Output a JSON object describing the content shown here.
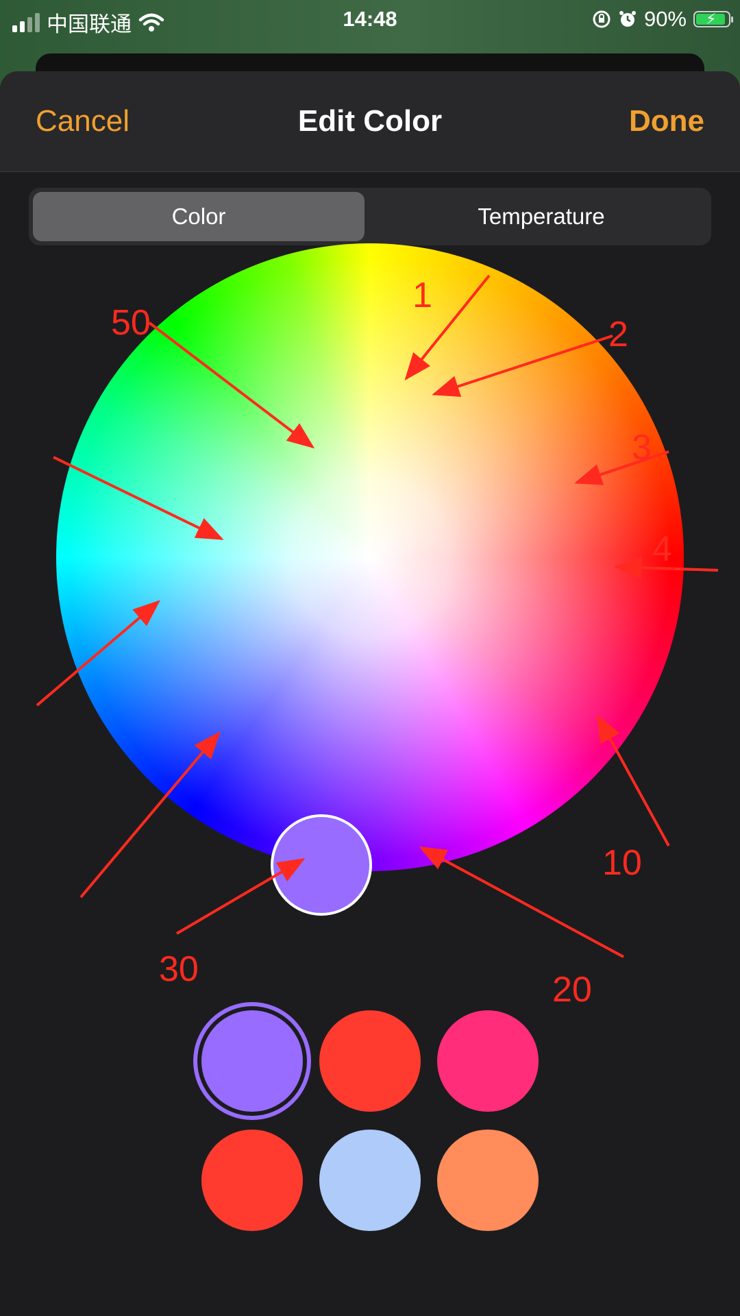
{
  "status_bar": {
    "carrier": "中国联通",
    "time": "14:48",
    "battery": "90%",
    "icons": [
      "signal-icon",
      "wifi-icon",
      "orientation-lock-icon",
      "alarm-icon",
      "battery-charging-icon"
    ]
  },
  "nav": {
    "cancel_label": "Cancel",
    "title": "Edit Color",
    "done_label": "Done",
    "accent_color": "#F0A030"
  },
  "segments": {
    "items": [
      "Color",
      "Temperature"
    ],
    "selected": "Color"
  },
  "color_wheel": {
    "selected_color": "#976CFF"
  },
  "swatches": [
    {
      "color": "#976CFF",
      "selected": true
    },
    {
      "color": "#FF3B30",
      "selected": false
    },
    {
      "color": "#FF2D7A",
      "selected": false
    },
    {
      "color": "#FF3B30",
      "selected": false
    },
    {
      "color": "#AECBFA",
      "selected": false
    },
    {
      "color": "#FF8C5A",
      "selected": false
    }
  ],
  "annotations": {
    "color": "#FF2A1F",
    "labels": [
      "1",
      "2",
      "3",
      "4",
      "10",
      "20",
      "30",
      "50"
    ]
  }
}
